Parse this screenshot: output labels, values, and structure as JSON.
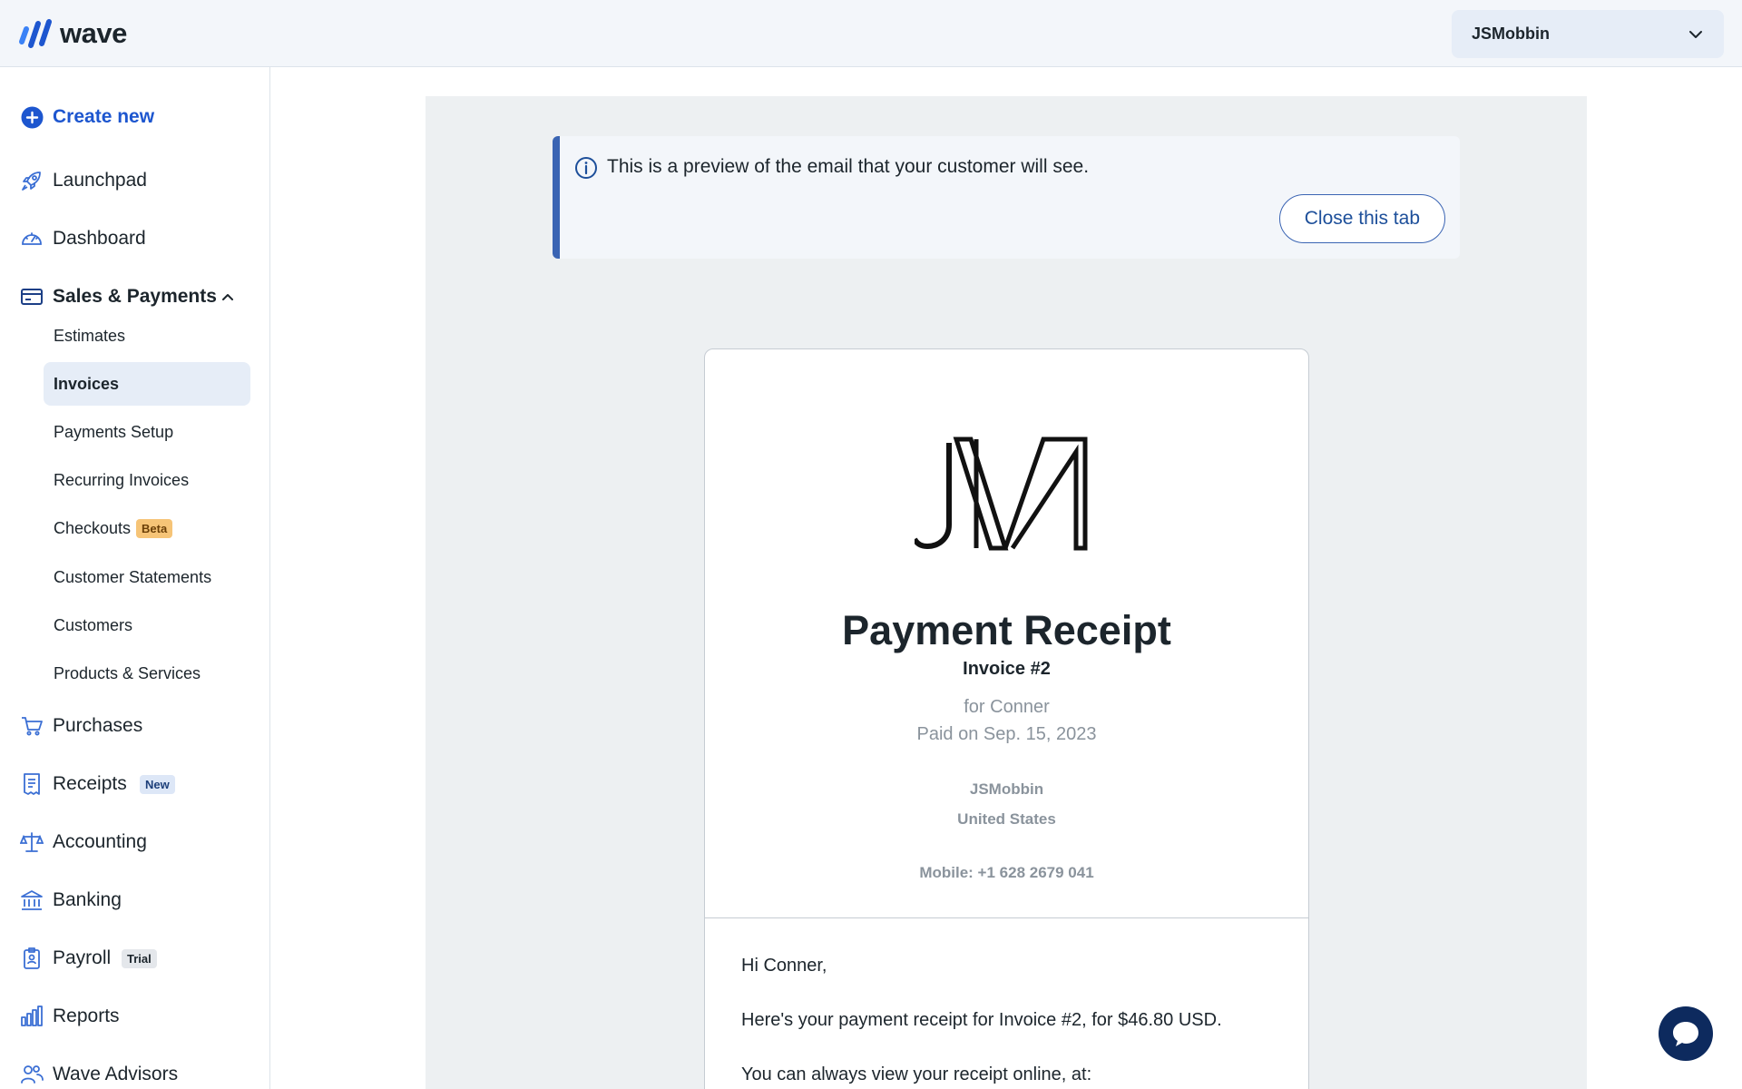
{
  "app": {
    "logo_text": "wave",
    "brand_color": "#1d56cf"
  },
  "topbar": {
    "business_name": "JSMobbin"
  },
  "sidebar": {
    "create_new": "Create new",
    "launchpad": "Launchpad",
    "dashboard": "Dashboard",
    "sales_payments": "Sales & Payments",
    "sub_items": {
      "estimates": "Estimates",
      "invoices": "Invoices",
      "payments_setup": "Payments Setup",
      "recurring_invoices": "Recurring Invoices",
      "checkouts": "Checkouts",
      "checkouts_badge": "Beta",
      "customer_statements": "Customer Statements",
      "customers": "Customers",
      "products_services": "Products & Services"
    },
    "purchases": "Purchases",
    "receipts": "Receipts",
    "receipts_badge": "New",
    "accounting": "Accounting",
    "banking": "Banking",
    "payroll": "Payroll",
    "payroll_badge": "Trial",
    "reports": "Reports",
    "wave_advisors": "Wave Advisors"
  },
  "notice": {
    "text": "This is a preview of the email that your customer will see.",
    "close_label": "Close this tab"
  },
  "receipt": {
    "title": "Payment Receipt",
    "invoice": "Invoice #2",
    "for": "for Conner",
    "paid_on": "Paid on Sep. 15, 2023",
    "business": "JSMobbin",
    "country": "United States",
    "mobile": "Mobile: +1 628 2679 041",
    "greeting": "Hi Conner,",
    "body_1": "Here's your payment receipt for Invoice #2, for $46.80 USD.",
    "body_2": "You can always view your receipt online, at:"
  }
}
